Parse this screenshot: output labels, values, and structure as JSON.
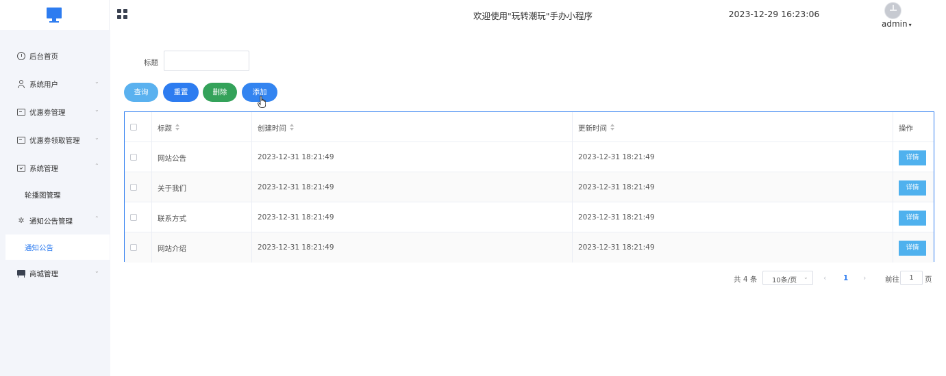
{
  "header": {
    "welcome": "欢迎使用\"玩转潮玩\"手办小程序",
    "datetime": "2023-12-29 16:23:06",
    "user": "admin"
  },
  "sidebar": {
    "items": [
      {
        "label": "后台首页",
        "icon": "clock-icon"
      },
      {
        "label": "系统用户",
        "icon": "user-icon",
        "arrow": "⌄"
      },
      {
        "label": "优惠劵管理",
        "icon": "card-icon",
        "arrow": "⌄"
      },
      {
        "label": "优惠劵领取管理",
        "icon": "card-icon",
        "arrow": "⌄"
      },
      {
        "label": "系统管理",
        "icon": "folder-icon",
        "arrow": "⌃"
      },
      {
        "label": "通知公告管理",
        "icon": "loading-icon",
        "arrow": "⌃"
      },
      {
        "label": "商城管理",
        "icon": "shop-icon",
        "arrow": "⌄"
      }
    ],
    "sub_items": {
      "carousel": "轮播图管理",
      "notice": "通知公告"
    }
  },
  "search": {
    "label": "标题",
    "value": "",
    "placeholder": ""
  },
  "toolbar": {
    "query": "查询",
    "reset": "重置",
    "delete": "删除",
    "add": "添加"
  },
  "table": {
    "columns": {
      "title": "标题",
      "created": "创建时间",
      "updated": "更新时间",
      "op": "操作"
    },
    "rows": [
      {
        "title": "网站公告",
        "created": "2023-12-31 18:21:49",
        "updated": "2023-12-31 18:21:49",
        "action": "详情"
      },
      {
        "title": "关于我们",
        "created": "2023-12-31 18:21:49",
        "updated": "2023-12-31 18:21:49",
        "action": "详情"
      },
      {
        "title": "联系方式",
        "created": "2023-12-31 18:21:49",
        "updated": "2023-12-31 18:21:49",
        "action": "详情"
      },
      {
        "title": "网站介绍",
        "created": "2023-12-31 18:21:49",
        "updated": "2023-12-31 18:21:49",
        "action": "详情"
      }
    ]
  },
  "pagination": {
    "total": "共 4 条",
    "page_size": "10条/页",
    "current": "1",
    "goto_label": "前往",
    "goto_value": "1",
    "goto_suffix": "页"
  },
  "colors": {
    "primary": "#2d7cf0",
    "query": "#5ab1ef",
    "delete": "#34a25a",
    "sidebar_bg": "#f3f5fa"
  }
}
